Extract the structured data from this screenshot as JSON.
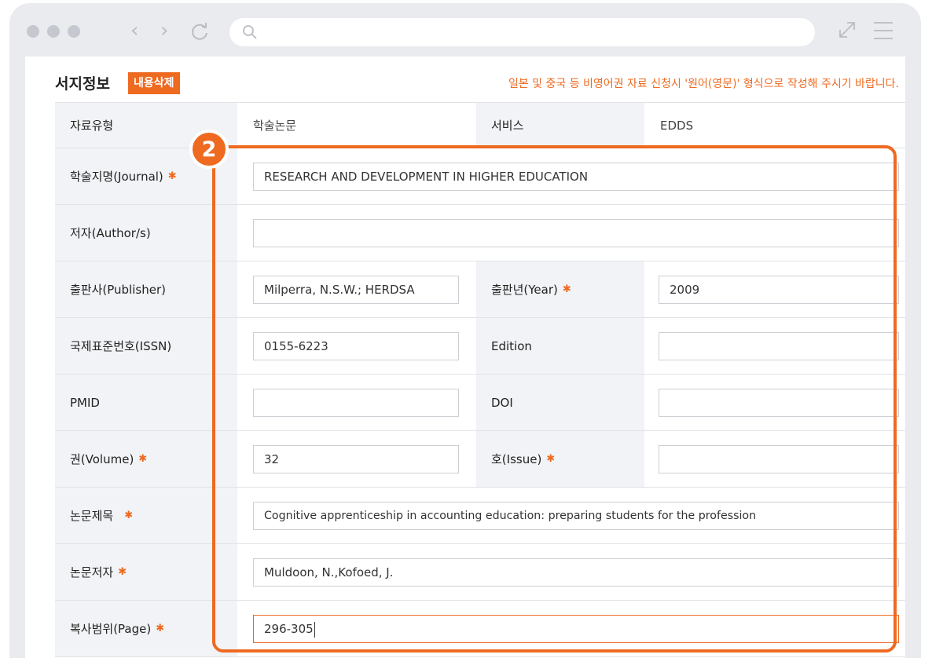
{
  "browser": {
    "icons": [
      "dot",
      "dot",
      "dot",
      "back-icon",
      "forward-icon",
      "reload-icon",
      "search-icon",
      "expand-icon",
      "menu-icon"
    ],
    "colors": {
      "chrome": "#e9ebee",
      "dot": "#c5c9cf",
      "accent": "#ee6a21"
    }
  },
  "form": {
    "section_title": "서지정보",
    "delete_label": "내용삭제",
    "notice": "일본 및 중국 등 비영어권 자료 신청시 '원어(영문)' 형식으로 작성해 주시기 바랍니다.",
    "required_mark": "✱",
    "step_badge": "2",
    "type_label": "자료유형",
    "type_value": "학술논문",
    "service_label": "서비스",
    "service_value": "EDDS",
    "journal_label": "학술지명(Journal)",
    "journal_value": "RESEARCH AND DEVELOPMENT IN HIGHER EDUCATION",
    "author_label": "저자(Author/s)",
    "author_value": "",
    "publisher_label": "출판사(Publisher)",
    "publisher_value": "Milperra, N.S.W.; HERDSA",
    "year_label": "출판년(Year)",
    "year_value": "2009",
    "issn_label": "국제표준번호(ISSN)",
    "issn_value": "0155-6223",
    "edition_label": "Edition",
    "edition_value": "",
    "pmid_label": "PMID",
    "pmid_value": "",
    "doi_label": "DOI",
    "doi_value": "",
    "volume_label": "권(Volume)",
    "volume_value": "32",
    "issue_label": "호(Issue)",
    "issue_value": "",
    "title_label": "논문제목",
    "title_value": "Cognitive apprenticeship in accounting education: preparing students for the profession",
    "paper_author_label": "논문저자",
    "paper_author_value": "Muldoon, N.,Kofoed, J.",
    "page_label": "복사범위(Page)",
    "page_value": "296-305"
  }
}
